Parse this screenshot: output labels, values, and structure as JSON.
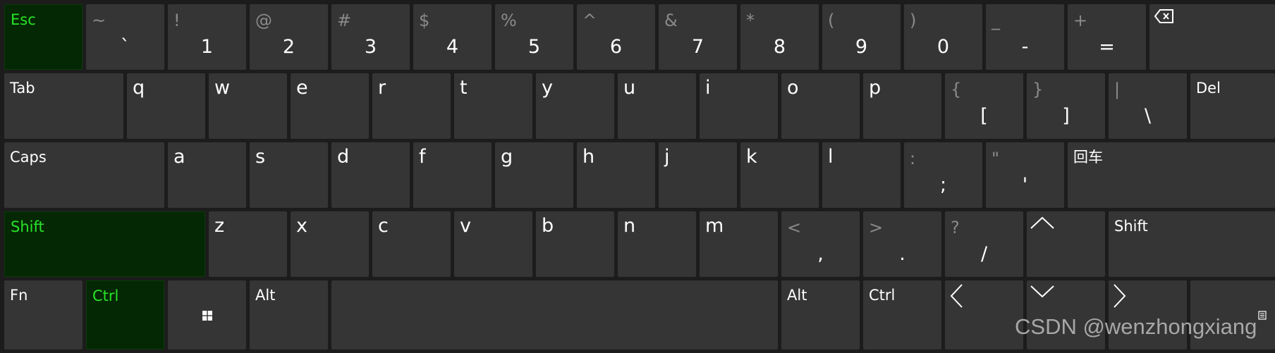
{
  "keyboard": {
    "row1": {
      "esc": "Esc",
      "keys": [
        {
          "shift": "~",
          "main": "`"
        },
        {
          "shift": "!",
          "main": "1"
        },
        {
          "shift": "@",
          "main": "2"
        },
        {
          "shift": "#",
          "main": "3"
        },
        {
          "shift": "$",
          "main": "4"
        },
        {
          "shift": "%",
          "main": "5"
        },
        {
          "shift": "^",
          "main": "6"
        },
        {
          "shift": "&",
          "main": "7"
        },
        {
          "shift": "*",
          "main": "8"
        },
        {
          "shift": "(",
          "main": "9"
        },
        {
          "shift": ")",
          "main": "0"
        },
        {
          "shift": "_",
          "main": "-"
        },
        {
          "shift": "+",
          "main": "="
        }
      ],
      "backspace_icon": "backspace-icon"
    },
    "row2": {
      "tab": "Tab",
      "letters": [
        "q",
        "w",
        "e",
        "r",
        "t",
        "y",
        "u",
        "i",
        "o",
        "p"
      ],
      "symbols": [
        {
          "shift": "{",
          "main": "["
        },
        {
          "shift": "}",
          "main": "]"
        },
        {
          "shift": "|",
          "main": "\\"
        }
      ],
      "del": "Del"
    },
    "row3": {
      "caps": "Caps",
      "letters": [
        "a",
        "s",
        "d",
        "f",
        "g",
        "h",
        "j",
        "k",
        "l"
      ],
      "symbols": [
        {
          "shift": ":",
          "main": ";"
        },
        {
          "shift": "\"",
          "main": "'"
        }
      ],
      "enter": "回车"
    },
    "row4": {
      "shift_left": "Shift",
      "letters": [
        "z",
        "x",
        "c",
        "v",
        "b",
        "n",
        "m"
      ],
      "symbols": [
        {
          "shift": "<",
          "main": ","
        },
        {
          "shift": ">",
          "main": "."
        },
        {
          "shift": "?",
          "main": "/"
        }
      ],
      "up_icon": "arrow-up-icon",
      "shift_right": "Shift"
    },
    "row5": {
      "fn": "Fn",
      "ctrl_left": "Ctrl",
      "win_icon": "windows-icon",
      "alt_left": "Alt",
      "alt_right": "Alt",
      "ctrl_right": "Ctrl",
      "left_icon": "arrow-left-icon",
      "down_icon": "arrow-down-icon",
      "right_icon": "arrow-right-icon",
      "menu_icon": "context-menu-icon"
    },
    "active_keys": [
      "Esc",
      "Shift",
      "Ctrl"
    ],
    "colors": {
      "key_bg": "#353535",
      "active_bg": "#042803",
      "active_text": "#29e329",
      "text": "#ffffff",
      "shift_text": "#8a8a8a",
      "background": "#1c1c1c"
    }
  },
  "watermark": "CSDN @wenzhongxiang"
}
